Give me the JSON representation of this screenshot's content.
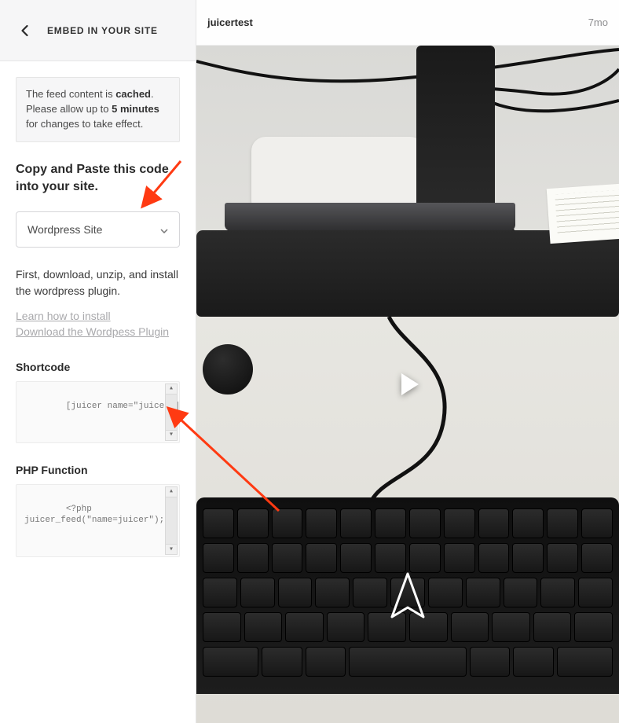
{
  "header": {
    "title": "EMBED IN YOUR SITE"
  },
  "notice": {
    "pre": "The feed content is ",
    "bold1": "cached",
    "mid": ". Please allow up to ",
    "bold2": "5 minutes",
    "post": " for changes to take effect."
  },
  "copy": {
    "heading": "Copy and Paste this code into your site."
  },
  "select": {
    "value": "Wordpress Site"
  },
  "instructions": "First, download, unzip, and install the wordpress plugin.",
  "links": {
    "learn": "Learn how to install",
    "download": "Download the Wordpess Plugin"
  },
  "shortcode": {
    "label": "Shortcode",
    "code": "[juicer name=\"juicer\"]"
  },
  "php": {
    "label": "PHP Function",
    "code": "<?php\njuicer_feed(\"name=juicer\"); ?"
  },
  "feed": {
    "username": "juicertest",
    "timestamp": "7mo"
  },
  "icons": {
    "back": "back-arrow",
    "caret": "chevron-down",
    "play": "play"
  }
}
